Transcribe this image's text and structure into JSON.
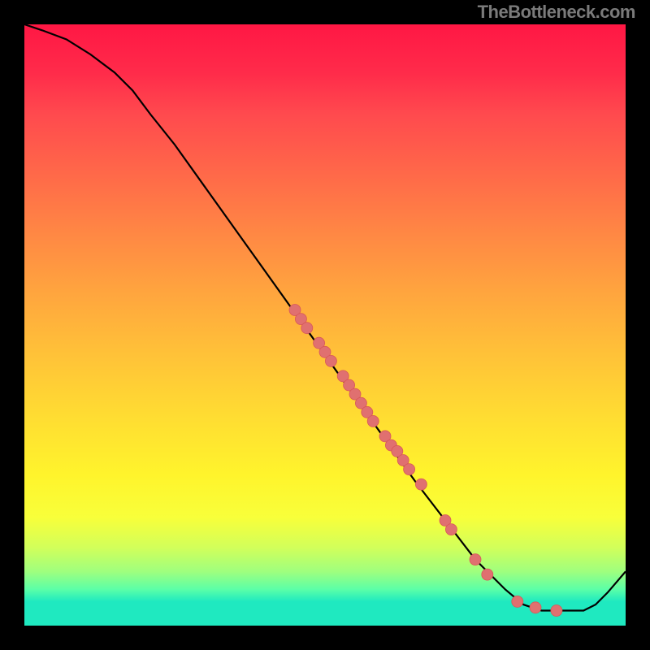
{
  "watermark": "TheBottleneck.com",
  "chart_data": {
    "type": "line",
    "title": "",
    "xlabel": "",
    "ylabel": "",
    "xlim": [
      0,
      100
    ],
    "ylim": [
      0,
      100
    ],
    "curve": [
      {
        "x": 0,
        "y": 100
      },
      {
        "x": 3,
        "y": 99
      },
      {
        "x": 7,
        "y": 97.5
      },
      {
        "x": 11,
        "y": 95
      },
      {
        "x": 15,
        "y": 92
      },
      {
        "x": 18,
        "y": 89
      },
      {
        "x": 21,
        "y": 85
      },
      {
        "x": 25,
        "y": 80
      },
      {
        "x": 30,
        "y": 73
      },
      {
        "x": 35,
        "y": 66
      },
      {
        "x": 40,
        "y": 59
      },
      {
        "x": 45,
        "y": 52
      },
      {
        "x": 50,
        "y": 45
      },
      {
        "x": 55,
        "y": 38
      },
      {
        "x": 60,
        "y": 31
      },
      {
        "x": 65,
        "y": 24
      },
      {
        "x": 70,
        "y": 17.5
      },
      {
        "x": 75,
        "y": 11
      },
      {
        "x": 80,
        "y": 6
      },
      {
        "x": 83,
        "y": 3.5
      },
      {
        "x": 86,
        "y": 2.5
      },
      {
        "x": 90,
        "y": 2.5
      },
      {
        "x": 93,
        "y": 2.5
      },
      {
        "x": 95,
        "y": 3.5
      },
      {
        "x": 97,
        "y": 5.5
      },
      {
        "x": 100,
        "y": 9
      }
    ],
    "scatter_points": [
      {
        "x": 45,
        "y": 52.5
      },
      {
        "x": 46,
        "y": 51
      },
      {
        "x": 47,
        "y": 49.5
      },
      {
        "x": 49,
        "y": 47
      },
      {
        "x": 50,
        "y": 45.5
      },
      {
        "x": 51,
        "y": 44
      },
      {
        "x": 53,
        "y": 41.5
      },
      {
        "x": 54,
        "y": 40
      },
      {
        "x": 55,
        "y": 38.5
      },
      {
        "x": 56,
        "y": 37
      },
      {
        "x": 57,
        "y": 35.5
      },
      {
        "x": 58,
        "y": 34
      },
      {
        "x": 60,
        "y": 31.5
      },
      {
        "x": 61,
        "y": 30
      },
      {
        "x": 62,
        "y": 29
      },
      {
        "x": 63,
        "y": 27.5
      },
      {
        "x": 64,
        "y": 26
      },
      {
        "x": 66,
        "y": 23.5
      },
      {
        "x": 70,
        "y": 17.5
      },
      {
        "x": 71,
        "y": 16
      },
      {
        "x": 75,
        "y": 11
      },
      {
        "x": 77,
        "y": 8.5
      },
      {
        "x": 82,
        "y": 4
      },
      {
        "x": 85,
        "y": 3
      },
      {
        "x": 88.5,
        "y": 2.5
      }
    ],
    "colors": {
      "line": "#000000",
      "point_fill": "#e07070",
      "point_stroke": "#d85858"
    }
  }
}
